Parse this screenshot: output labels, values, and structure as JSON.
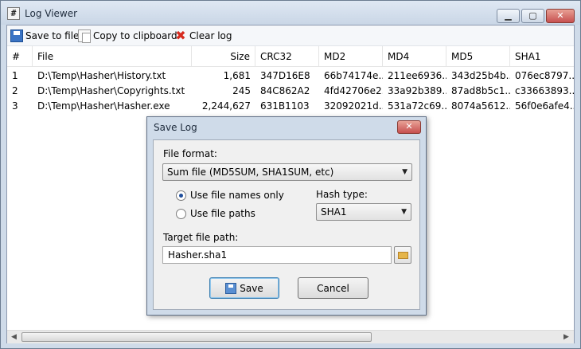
{
  "window": {
    "icon_glyph": "#",
    "title": "Log Viewer",
    "controls": {
      "minimize": "▁",
      "maximize": "▢",
      "close": "✕"
    }
  },
  "toolbar": {
    "save_label": "Save to file",
    "copy_label": "Copy to clipboard",
    "clear_label": "Clear log",
    "clear_icon": "✖"
  },
  "table": {
    "columns": [
      "#",
      "File",
      "Size",
      "CRC32",
      "MD2",
      "MD4",
      "MD5",
      "SHA1"
    ],
    "rows": [
      [
        "1",
        "D:\\Temp\\Hasher\\History.txt",
        "1,681",
        "347D16E8",
        "66b74174e...",
        "211ee6936...",
        "343d25b4b...",
        "076ec8797..."
      ],
      [
        "2",
        "D:\\Temp\\Hasher\\Copyrights.txt",
        "245",
        "84C862A2",
        "4fd42706e2...",
        "33a92b389...",
        "87ad8b5c1...",
        "c33663893..."
      ],
      [
        "3",
        "D:\\Temp\\Hasher\\Hasher.exe",
        "2,244,627",
        "631B1103",
        "32092021d...",
        "531a72c69...",
        "8074a5612...",
        "56f0e6afe4..."
      ]
    ]
  },
  "scrollbar": {
    "left_arrow": "◀",
    "right_arrow": "▶"
  },
  "dialog": {
    "title": "Save Log",
    "close_glyph": "✕",
    "file_format_label": "File format:",
    "file_format_value": "Sum file (MD5SUM, SHA1SUM, etc)",
    "radio_names_only": "Use file names only",
    "radio_paths": "Use file paths",
    "hash_type_label": "Hash type:",
    "hash_type_value": "SHA1",
    "target_label": "Target file path:",
    "target_value": "Hasher.sha1",
    "save_button": "Save",
    "cancel_button": "Cancel",
    "dropdown_arrow": "▼"
  },
  "colors": {
    "accent": "#1f4e9c",
    "close": "#c75050"
  }
}
